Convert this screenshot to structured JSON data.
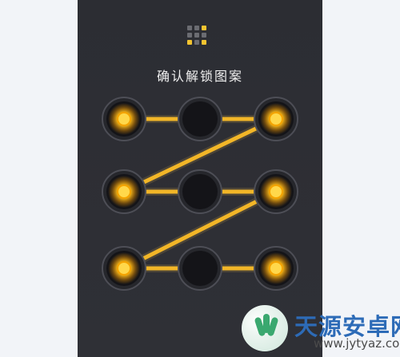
{
  "screen": {
    "prompt": "确认解锁图案"
  },
  "mini_pattern": {
    "cells": [
      {
        "active": false
      },
      {
        "active": false
      },
      {
        "active": true
      },
      {
        "active": false
      },
      {
        "active": false
      },
      {
        "active": false
      },
      {
        "active": true
      },
      {
        "active": false
      },
      {
        "active": true
      }
    ]
  },
  "pattern": {
    "selected_nodes": [
      1,
      3,
      4,
      6,
      7,
      9
    ],
    "line_order": [
      1,
      3,
      4,
      6,
      7,
      9
    ],
    "colors": {
      "line": "#f2b628",
      "selected": "#ffd84b"
    }
  },
  "watermark": {
    "title": "天源安卓网",
    "domain": "www.jytyaz.com"
  }
}
